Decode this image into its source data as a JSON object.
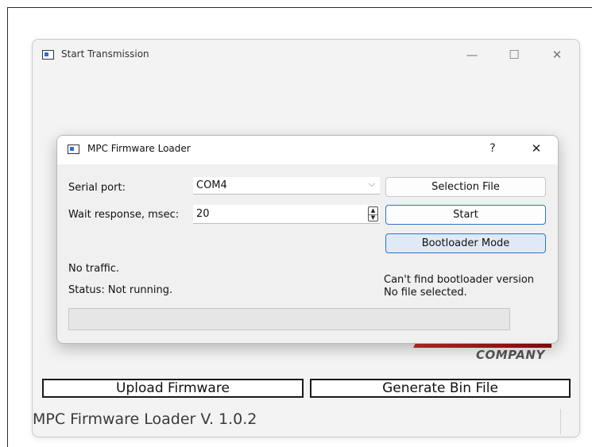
{
  "main_window": {
    "title": "Start Transmission",
    "controls": {
      "minimize": "—",
      "maximize": "☐",
      "close": "✕"
    },
    "logo": {
      "company_text": "COMPANY"
    },
    "buttons": {
      "upload": "Upload Firmware",
      "generate": "Generate Bin File"
    },
    "footer_label": "MPC Firmware Loader V. 1.0.2"
  },
  "dialog": {
    "title": "MPC Firmware Loader",
    "controls": {
      "help": "?",
      "close": "✕"
    },
    "serial_port": {
      "label": "Serial port:",
      "value": "COM4"
    },
    "wait_response": {
      "label": "Wait response, msec:",
      "value": "20"
    },
    "buttons": {
      "selection_file": "Selection File",
      "start": "Start",
      "bootloader_mode": "Bootloader Mode"
    },
    "traffic_text": "No traffic.",
    "status_text": "Status: Not running.",
    "bootloader_version_text": "Can't find bootloader version",
    "file_text": "No file selected.",
    "progress_fraction": 0
  }
}
